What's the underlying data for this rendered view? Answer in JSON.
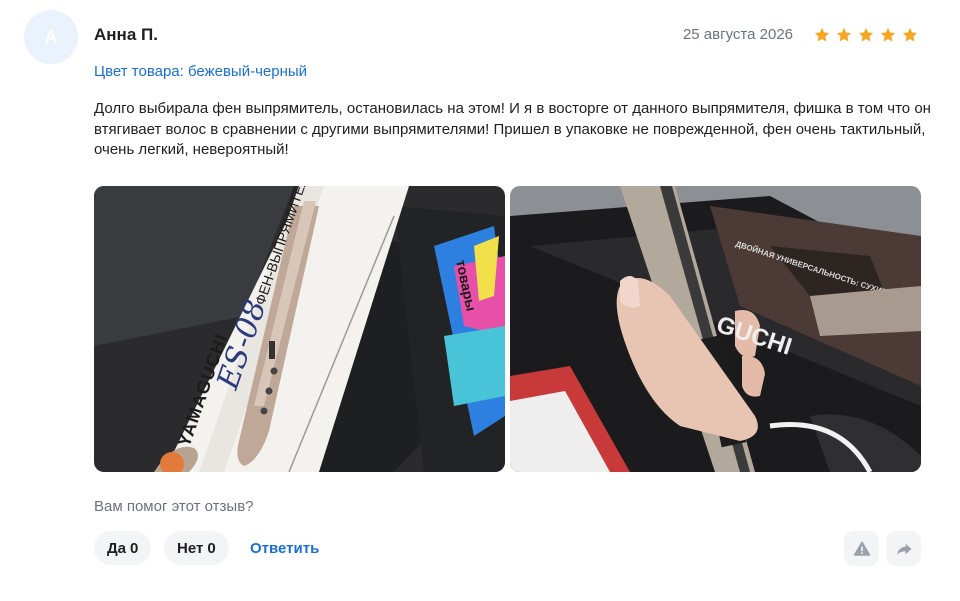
{
  "review": {
    "avatar_letter": "А",
    "author": "Анна П.",
    "date": "25 августа 2026",
    "rating": 5,
    "variant": "Цвет товара: бежевый-черный",
    "text": "Долго выбирала фен выпрямитель, остановилась на этом! И я в восторге от данного выпрямителя, фишка в том что он втягивает волос в сравнении с другими выпрямителями! Пришел в упаковке не поврежденной, фен очень тактильный, очень легкий, невероятный!",
    "photos": [
      {
        "brand": "YAMAGUCHI",
        "label": "ФЕН-ВЫПРЯМИТЕЛЬ",
        "marker": "ES-08",
        "bag_text": "товары"
      },
      {
        "brand": "GUCHI",
        "box_text": "ДВОЙНАЯ УНИВЕРСАЛЬНОСТЬ: СУХИЕ И ВЛАЖНЫЕ ВОЛОСЫ"
      }
    ]
  },
  "feedback": {
    "question": "Вам помог этот отзыв?",
    "yes_label": "Да",
    "yes_count": "0",
    "no_label": "Нет",
    "no_count": "0",
    "reply_label": "Ответить"
  },
  "icons": {
    "star": "star-icon",
    "report": "warning-icon",
    "share": "share-icon"
  },
  "colors": {
    "star": "#f5a623",
    "link": "#1a6fd8",
    "button_bg": "#f3f4f6",
    "avatar_bg": "#eaf2fd"
  }
}
